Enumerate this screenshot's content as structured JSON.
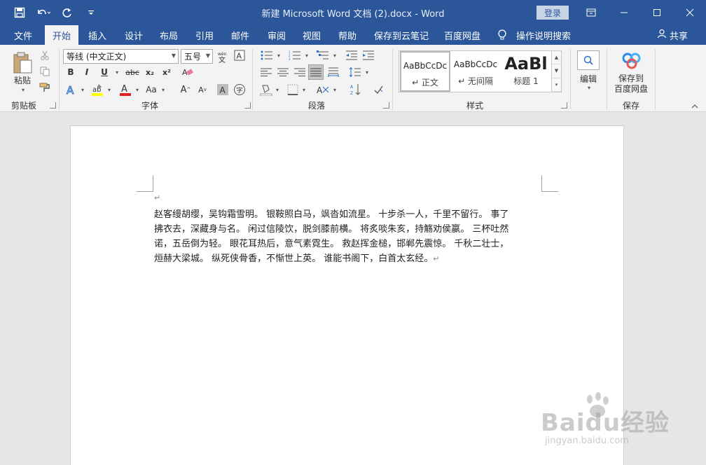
{
  "window": {
    "title": "新建 Microsoft Word 文档 (2).docx  -  Word",
    "login_label": "登录"
  },
  "menu": {
    "tabs": [
      "文件",
      "开始",
      "插入",
      "设计",
      "布局",
      "引用",
      "邮件",
      "审阅",
      "视图",
      "帮助",
      "保存到云笔记",
      "百度网盘"
    ],
    "active_tab": "开始",
    "tell_me": "操作说明搜索",
    "share": "共享"
  },
  "ribbon": {
    "clipboard": {
      "label": "剪贴板",
      "paste": "粘贴"
    },
    "font": {
      "label": "字体",
      "font_name": "等线 (中文正文)",
      "font_size": "五号",
      "bold": "B",
      "italic": "I",
      "underline": "U",
      "strikethrough": "abc",
      "subscript": "x₂",
      "superscript": "x²",
      "change_case": "Aa",
      "grow": "A",
      "shrink": "A"
    },
    "paragraph": {
      "label": "段落"
    },
    "styles": {
      "label": "样式",
      "items": [
        {
          "sample": "AaBbCcDc",
          "name": "↵ 正文"
        },
        {
          "sample": "AaBbCcDc",
          "name": "↵ 无间隔"
        },
        {
          "sample": "AaBl",
          "name": "标题 1"
        }
      ]
    },
    "editing": {
      "label": "编辑"
    },
    "save": {
      "label": "保存",
      "button": "保存到\n百度网盘",
      "line1": "保存到",
      "line2": "百度网盘"
    }
  },
  "document": {
    "lines": [
      "赵客缦胡缨，吴钩霜雪明。 银鞍照白马，飒沓如流星。 十步杀一人，千里不留行。 事了",
      "拂衣去，深藏身与名。 闲过信陵饮，脱剑膝前横。 将炙啖朱亥，持觞劝侯嬴。 三杯吐然",
      "诺，五岳倒为轻。 眼花耳热后，意气素霓生。 救赵挥金槌，邯郸先震惊。 千秋二壮士，",
      "烜赫大梁城。 纵死侠骨香，不惭世上英。 谁能书阁下，白首太玄经。"
    ],
    "para_mark": "↵"
  },
  "watermark": {
    "main": "Baidu经验",
    "sub": "jingyan.baidu.com"
  },
  "colors": {
    "accent": "#2b579a",
    "ribbon_bg": "#f3f3f3",
    "canvas_bg": "#e6e6e6"
  }
}
